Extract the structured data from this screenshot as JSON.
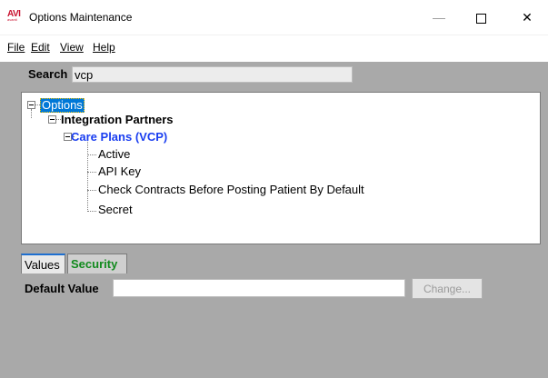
{
  "window": {
    "title": "Options Maintenance",
    "logo_text": "AVI",
    "logo_subtext": "avanti",
    "minimize_glyph": "—",
    "close_glyph": "✕"
  },
  "menu": {
    "items": [
      {
        "label": "File"
      },
      {
        "label": "Edit"
      },
      {
        "label": "View"
      },
      {
        "label": "Help"
      }
    ]
  },
  "search": {
    "label": "Search",
    "value": "vcp"
  },
  "tree": {
    "root": "Options",
    "partners": "Integration Partners",
    "care_plans": "Care Plans (VCP)",
    "leaves": [
      "Active",
      "API Key",
      "Check Contracts Before Posting Patient By Default",
      "Secret"
    ],
    "selected": "Options"
  },
  "tabs": {
    "values_label": "Values",
    "security_label": "Security",
    "active": "Values"
  },
  "default_value": {
    "label": "Default Value",
    "value": "",
    "change_label": "Change..."
  },
  "colors": {
    "selection_bg": "#0078d7",
    "care_plans_text": "#1a3ef0",
    "security_tab_text": "#118a1d",
    "panel_bg": "#a9a9a9"
  }
}
